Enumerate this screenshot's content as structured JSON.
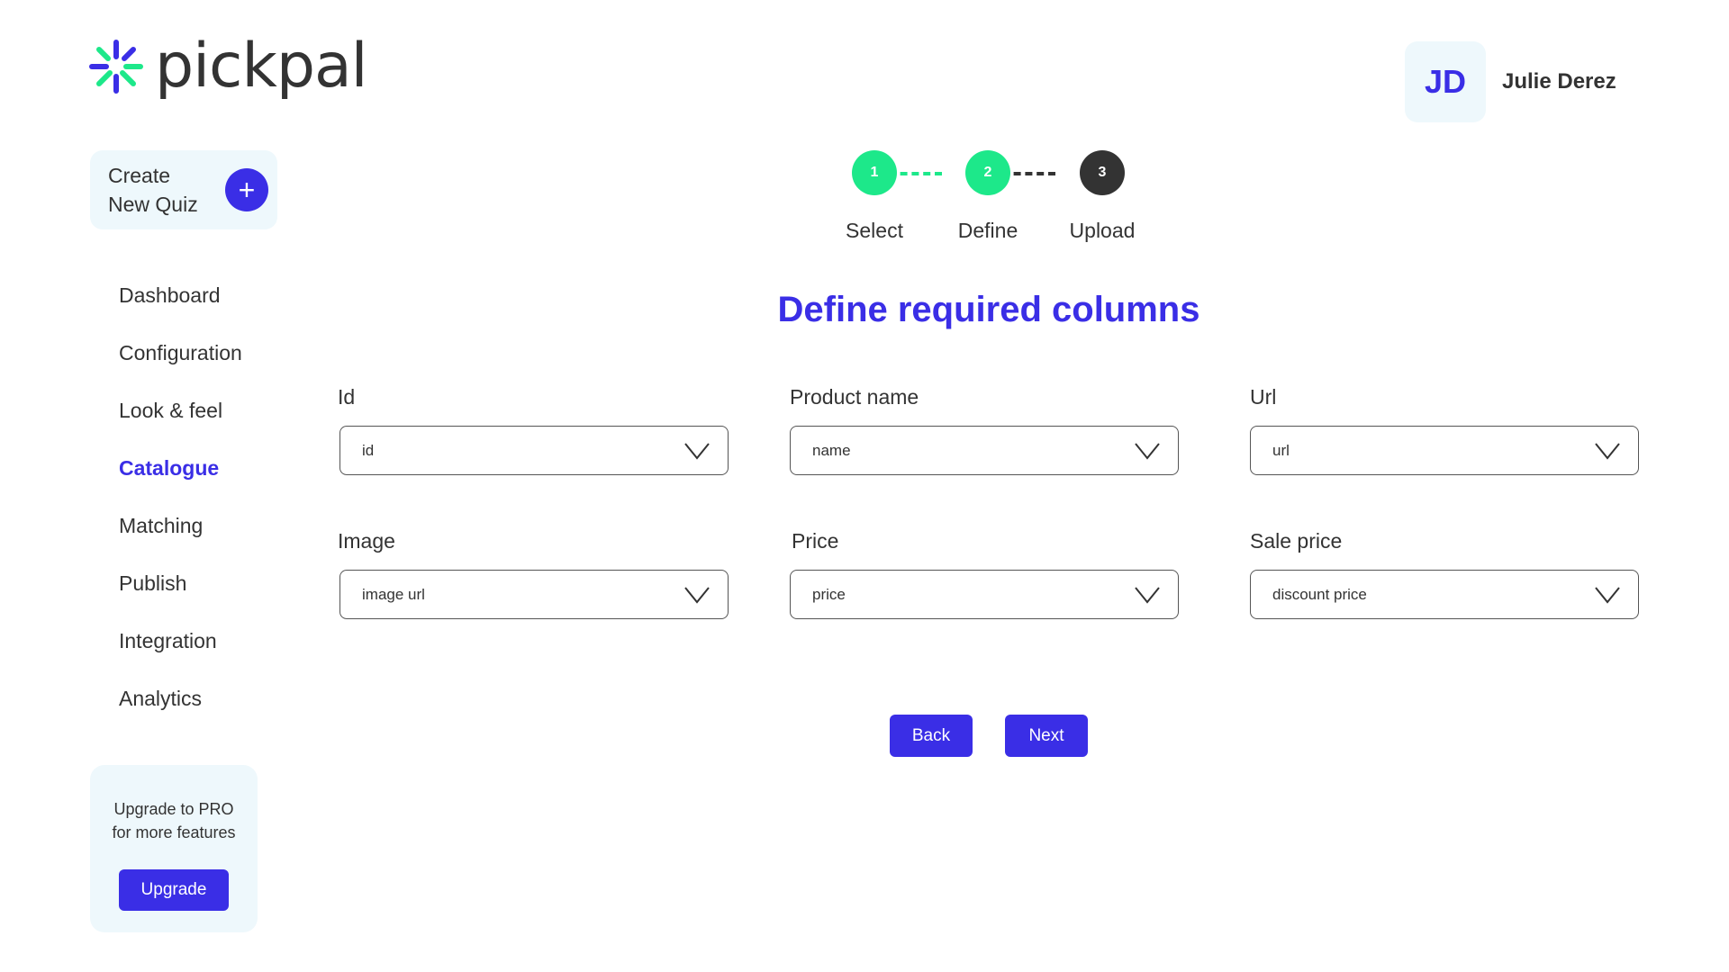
{
  "brand": {
    "name": "pickpal"
  },
  "user": {
    "initials": "JD",
    "name": "Julie Derez"
  },
  "sidebar": {
    "create_label": "Create\nNew Quiz",
    "create_icon": "plus-icon",
    "items": [
      {
        "label": "Dashboard",
        "active": false
      },
      {
        "label": "Configuration",
        "active": false
      },
      {
        "label": "Look & feel",
        "active": false
      },
      {
        "label": "Catalogue",
        "active": true
      },
      {
        "label": "Matching",
        "active": false
      },
      {
        "label": "Publish",
        "active": false
      },
      {
        "label": "Integration",
        "active": false
      },
      {
        "label": "Analytics",
        "active": false
      }
    ],
    "upgrade_text": "Upgrade to PRO\nfor more features",
    "upgrade_button": "Upgrade"
  },
  "stepper": {
    "current_step": 2,
    "steps": [
      {
        "number": "1",
        "label": "Select",
        "state": "done"
      },
      {
        "number": "2",
        "label": "Define",
        "state": "current"
      },
      {
        "number": "3",
        "label": "Upload",
        "state": "pending"
      }
    ]
  },
  "main": {
    "title": "Define required columns",
    "fields": [
      {
        "label": "Id",
        "value": "id"
      },
      {
        "label": "Product name",
        "value": "name"
      },
      {
        "label": "Url",
        "value": "url"
      },
      {
        "label": "Image",
        "value": "image url"
      },
      {
        "label": "Price",
        "value": "price"
      },
      {
        "label": "Sale price",
        "value": "discount price"
      }
    ],
    "back_button": "Back",
    "next_button": "Next"
  },
  "colors": {
    "accent": "#3a2ee6",
    "step_active": "#1de88a",
    "step_pending": "#333333",
    "card_background": "#eef8fc"
  }
}
